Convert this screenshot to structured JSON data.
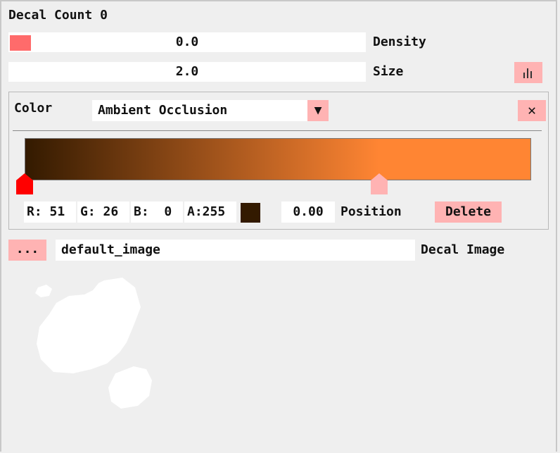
{
  "decal_count": {
    "label": "Decal Count",
    "value": "0"
  },
  "density": {
    "value": "0.0",
    "label": "Density",
    "fill_fraction": 0.0
  },
  "size": {
    "value": "2.0",
    "label": "Size",
    "chart_icon": "bar-chart-icon"
  },
  "color_group": {
    "label": "Color",
    "mode_value": "Ambient Occlusion",
    "dropdown_icon": "triangle-down-icon",
    "close_icon": "close-icon",
    "close_glyph": "✕",
    "dropdown_glyph": "▼",
    "gradient_colors": [
      "#331a00",
      "#ff8533"
    ],
    "stops": [
      {
        "position": 0.0,
        "color": "#ff0000",
        "selected": true
      },
      {
        "position": 0.7,
        "color": "#ffb3b3",
        "selected": false
      }
    ],
    "r": "R: 51",
    "g": "G: 26",
    "b": "B:  0",
    "a": "A:255",
    "swatch_color": "#331a00",
    "position_value": "0.00",
    "position_label": "Position",
    "delete_label": "Delete"
  },
  "decal_image": {
    "browse_label": "...",
    "value": "default_image",
    "label": "Decal Image"
  }
}
